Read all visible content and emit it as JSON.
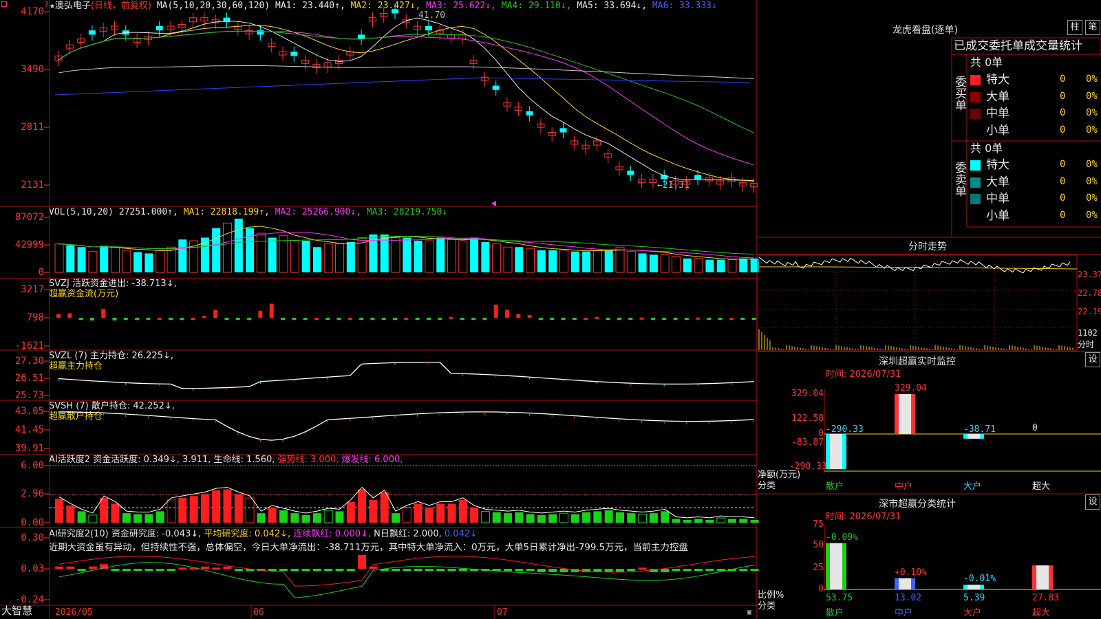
{
  "header": {
    "star": "★",
    "stock_name": "澳弘电子",
    "period": "(日线，前复权)",
    "ma_label": "MA(5,10,20,30,60,120)",
    "ma": [
      {
        "t": "MA1: 23.440↑,",
        "c": "w"
      },
      {
        "t": "MA2: 23.427↓,",
        "c": "y"
      },
      {
        "t": "MA3: 25.622↓,",
        "c": "m"
      },
      {
        "t": "MA4: 29.110↓,",
        "c": "g"
      },
      {
        "t": "MA5: 33.694↓,",
        "c": "w"
      },
      {
        "t": "MA6: 33.333↓",
        "c": "b"
      }
    ]
  },
  "price_axis": [
    "4170",
    "3490",
    "2811",
    "2131"
  ],
  "price_marks": {
    "high": "41.70",
    "low": "←21.31"
  },
  "vol": {
    "head": "VOL(5,10,20)  27251.000↑,",
    "ma": [
      {
        "t": "MA1: 22818.199↑,",
        "c": "y"
      },
      {
        "t": "MA2: 25266.900↓,",
        "c": "m"
      },
      {
        "t": "MA3: 28219.750↓",
        "c": "g"
      }
    ],
    "axis": [
      "87072",
      "42999",
      "0"
    ]
  },
  "svzj": {
    "l1": "SVZJ  活跃资金进出: -38.713↓,",
    "l2": "超赢资金流(万元)",
    "axis": [
      "3217",
      "798",
      "-1621"
    ]
  },
  "svzl": {
    "l1": "SVZL (7) 主力持仓: 26.225↓,",
    "l2": "超赢主力持仓",
    "axis": [
      "27.30",
      "26.51",
      "25.73"
    ]
  },
  "svsh": {
    "l1": "SVSH (7) 散户持仓: 42.252↓,",
    "l2": "超赢散户持仓",
    "axis": [
      "43.05",
      "41.45",
      "39.91"
    ]
  },
  "ai1": {
    "parts": [
      {
        "t": "AI活跃度2 资金活跃度: 0.349↓, 3.911,",
        "c": "w"
      },
      {
        "t": "生命线: 1.560,",
        "c": "w"
      },
      {
        "t": "强势线: 3.000,",
        "c": "r"
      },
      {
        "t": "爆发线: 6.000,",
        "c": "m"
      }
    ],
    "axis": [
      "6.00",
      "2.96",
      "0.00"
    ]
  },
  "ai2": {
    "parts": [
      {
        "t": "AI研究度2(10) 资金研究度: -0.043↓,",
        "c": "w"
      },
      {
        "t": "平均研究度: 0.042↓,",
        "c": "y"
      },
      {
        "t": "连续飘红: 0.000↓,",
        "c": "m"
      },
      {
        "t": "N日飘红: 2.000,",
        "c": "w"
      },
      {
        "t": "0.042↓",
        "c": "b"
      }
    ],
    "comment": "近期大资金虽有异动，但持续性不强，总体偏空，今日大单净流出：-38.711万元，其中特大单净流入：0万元，大单5日累计净出-799.5万元，当前主力控盘",
    "axis": [
      "0.30",
      "0.03",
      "-0.24"
    ]
  },
  "dates": {
    "brand": "大智慧",
    "d1": "2026/05",
    "d2": "06",
    "d3": "07"
  },
  "lhb": {
    "title": "龙虎看盘(逐单)",
    "btn1": "柱",
    "btn2": "笔",
    "headline": "已成交委托单成交量统计",
    "buy_label": "委买单",
    "sell_label": "委卖单",
    "buy_total": "共 0单",
    "sell_total": "共 0单",
    "buy_rows": [
      {
        "n": "特大",
        "v": "0",
        "p": "0%",
        "color": "#ff1e1e"
      },
      {
        "n": "大单",
        "v": "0",
        "p": "0%",
        "color": "#8c0000"
      },
      {
        "n": "中单",
        "v": "0",
        "p": "0%",
        "color": "#6e0000"
      },
      {
        "n": "小单",
        "v": "0",
        "p": "0%",
        "color": ""
      }
    ],
    "sell_rows": [
      {
        "n": "特大",
        "v": "0",
        "p": "0%",
        "color": "#00ffff"
      },
      {
        "n": "大单",
        "v": "0",
        "p": "0%",
        "color": "#008c8c"
      },
      {
        "n": "中单",
        "v": "0",
        "p": "0%",
        "color": "#007878"
      },
      {
        "n": "小单",
        "v": "0",
        "p": "0%",
        "color": ""
      }
    ]
  },
  "minute": {
    "title": "分时走势",
    "axis": [
      "23.37",
      "22.78",
      "22.19"
    ],
    "vol_axis": "1102",
    "vol_unit": "分时"
  },
  "sz_monitor": {
    "title": "深圳超赢实时监控",
    "btn": "设",
    "time": "时间: 2026/07/31",
    "axis": [
      "329.04",
      "122.58",
      "0",
      "-83.87",
      "-290.33"
    ],
    "bars": [
      {
        "cat": "散户",
        "val": "-290.33"
      },
      {
        "cat": "中户",
        "val": "329.04"
      },
      {
        "cat": "大户",
        "val": "-38.71"
      },
      {
        "cat": "超大",
        "val": "0"
      }
    ],
    "label1": "净额(万元)",
    "label2": "分类"
  },
  "sz_stats": {
    "title": "深市超赢分类统计",
    "btn": "设",
    "time": "时间: 2026/07/31",
    "axis": [
      "75",
      "50",
      "25",
      "0"
    ],
    "bars": [
      {
        "cat": "散户",
        "chg": "-0.09%",
        "val": "53.75"
      },
      {
        "cat": "中户",
        "chg": "+0.10%",
        "val": "13.02"
      },
      {
        "cat": "大户",
        "chg": "-0.01%",
        "val": "5.39"
      },
      {
        "cat": "超大",
        "chg": "",
        "val": "27.83"
      }
    ],
    "label1": "比例%",
    "label2": "分类"
  }
}
